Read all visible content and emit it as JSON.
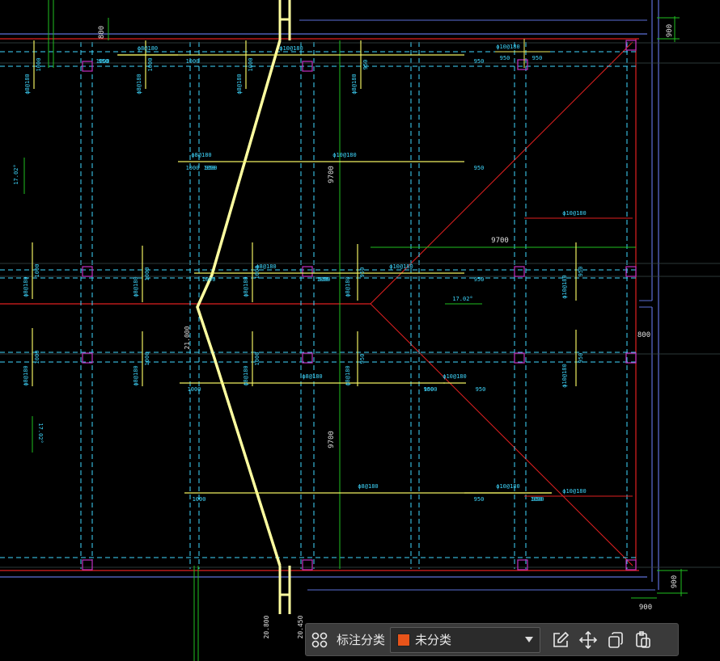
{
  "toolbar": {
    "category_label": "标注分类",
    "category_value": "未分类",
    "category_color": "#e8541a",
    "icons": [
      "grid-icon",
      "edit-icon",
      "move-icon",
      "copy-icon",
      "paste-icon"
    ]
  },
  "drawing": {
    "dims_top": [
      "800",
      "900"
    ],
    "dims_right": [
      "900",
      "800",
      "900",
      "900"
    ],
    "span_labels": [
      "9700",
      "9700",
      "9700"
    ],
    "slope_labels": [
      "17.02°",
      "17.02°",
      "17.02°"
    ],
    "cut_labels": [
      "21.000",
      "20.800",
      "20.450"
    ],
    "rebar_main": [
      "ϕ8@180",
      "ϕ8@180",
      "ϕ8@180",
      "ϕ8@180",
      "ϕ10@180",
      "ϕ10@180",
      "ϕ10@180",
      "ϕ10@180"
    ],
    "rebar_edge": [
      "ϕ10@180",
      "ϕ10@180"
    ],
    "len_1000": "1000",
    "len_950": "950",
    "len_900": "900"
  }
}
